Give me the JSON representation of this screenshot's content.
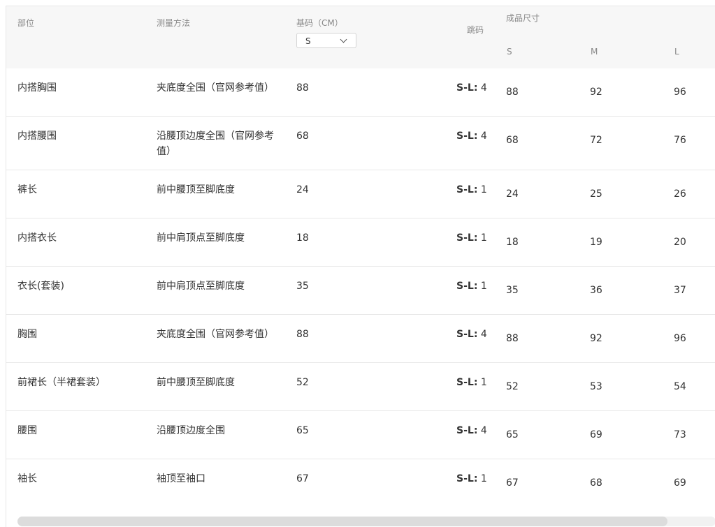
{
  "header": {
    "part": "部位",
    "method": "测量方法",
    "base": "基码（CM）",
    "size_select": {
      "value": "S"
    },
    "jump": "跳码",
    "finished": "成品尺寸",
    "sizes": [
      "S",
      "M",
      "L"
    ]
  },
  "rows": [
    {
      "part": "内搭胸围",
      "method": "夹底度全围（官网参考值）",
      "base": "88",
      "jump_label": "S-L:",
      "jump_value": " 4",
      "s": "88",
      "m": "92",
      "l": "96"
    },
    {
      "part": "内搭腰围",
      "method": "沿腰顶边度全围（官网参考值）",
      "base": "68",
      "jump_label": "S-L:",
      "jump_value": " 4",
      "s": "68",
      "m": "72",
      "l": "76"
    },
    {
      "part": "裤长",
      "method": "前中腰顶至脚底度",
      "base": "24",
      "jump_label": "S-L:",
      "jump_value": " 1",
      "s": "24",
      "m": "25",
      "l": "26"
    },
    {
      "part": "内搭衣长",
      "method": "前中肩顶点至脚底度",
      "base": "18",
      "jump_label": "S-L:",
      "jump_value": " 1",
      "s": "18",
      "m": "19",
      "l": "20"
    },
    {
      "part": "衣长(套装)",
      "method": "前中肩顶点至脚底度",
      "base": "35",
      "jump_label": "S-L:",
      "jump_value": " 1",
      "s": "35",
      "m": "36",
      "l": "37"
    },
    {
      "part": "胸围",
      "method": "夹底度全围（官网参考值）",
      "base": "88",
      "jump_label": "S-L:",
      "jump_value": " 4",
      "s": "88",
      "m": "92",
      "l": "96"
    },
    {
      "part": "前裙长（半裙套装）",
      "method": "前中腰顶至脚底度",
      "base": "52",
      "jump_label": "S-L:",
      "jump_value": " 1",
      "s": "52",
      "m": "53",
      "l": "54"
    },
    {
      "part": "腰围",
      "method": "沿腰顶边度全围",
      "base": "65",
      "jump_label": "S-L:",
      "jump_value": " 4",
      "s": "65",
      "m": "69",
      "l": "73"
    },
    {
      "part": "袖长",
      "method": "袖顶至袖口",
      "base": "67",
      "jump_label": "S-L:",
      "jump_value": " 1",
      "s": "67",
      "m": "68",
      "l": "69"
    }
  ]
}
